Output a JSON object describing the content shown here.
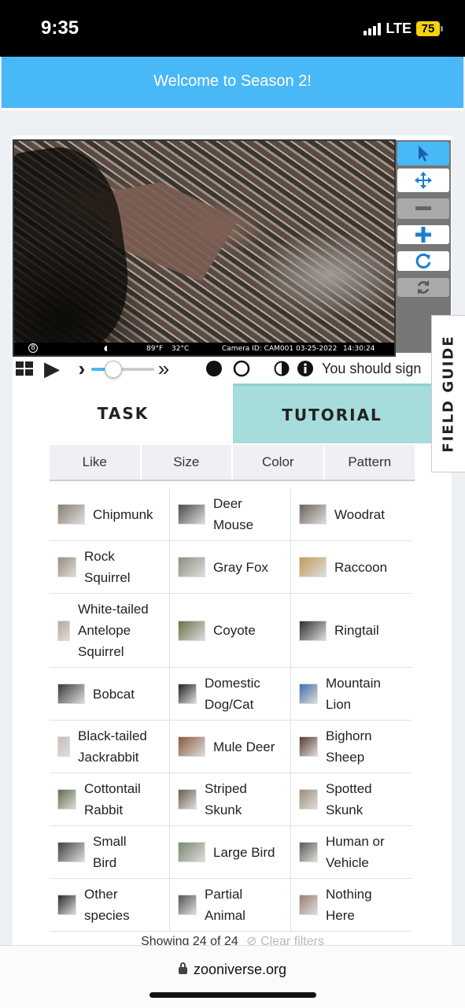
{
  "status_bar": {
    "time": "9:35",
    "network": "LTE",
    "battery": "75"
  },
  "banner": {
    "text": "Welcome to Season 2!"
  },
  "viewer": {
    "caption": {
      "moon": "◖",
      "temp_f": "89°F",
      "temp_c": "32°C",
      "camera": "Camera ID: CAM001",
      "date": "03-25-2022",
      "time": "14:30:24",
      "logo": "8"
    },
    "tools": [
      "pointer-icon",
      "move-icon",
      "zoom-out-icon",
      "zoom-in-icon",
      "rotate-icon",
      "reset-icon"
    ]
  },
  "controls": {
    "play": "▶",
    "next": "›",
    "fast_forward": "»",
    "sign_in_text": "You should sign",
    "slider_value": 0.25
  },
  "tabs": {
    "task": "TASK",
    "tutorial": "TUTORIAL"
  },
  "field_guide": {
    "label": "FIELD GUIDE"
  },
  "filters": [
    "Like",
    "Size",
    "Color",
    "Pattern"
  ],
  "species": [
    {
      "name": "Chipmunk",
      "thumb": "#8a7e72"
    },
    {
      "name": "Deer Mouse",
      "thumb": "#4a4a4a"
    },
    {
      "name": "Woodrat",
      "thumb": "#6e6458"
    },
    {
      "name": "Rock Squirrel",
      "thumb": "#9a8b78"
    },
    {
      "name": "Gray Fox",
      "thumb": "#8e8e80"
    },
    {
      "name": "Raccoon",
      "thumb": "#c49a5a"
    },
    {
      "name": "White-tailed Antelope Squirrel",
      "thumb": "#b9a693"
    },
    {
      "name": "Coyote",
      "thumb": "#6e7048"
    },
    {
      "name": "Ringtail",
      "thumb": "#2e2e2e"
    },
    {
      "name": "Bobcat",
      "thumb": "#3a3a3a"
    },
    {
      "name": "Domestic Dog/Cat",
      "thumb": "#222222"
    },
    {
      "name": "Mountain Lion",
      "thumb": "#3e6fa8"
    },
    {
      "name": "Black-tailed Jackrabbit",
      "thumb": "#c8c0b8"
    },
    {
      "name": "Mule Deer",
      "thumb": "#8a5a3a"
    },
    {
      "name": "Bighorn Sheep",
      "thumb": "#5a3a32"
    },
    {
      "name": "Cottontail Rabbit",
      "thumb": "#5e6e4a"
    },
    {
      "name": "Striped Skunk",
      "thumb": "#6a5e50"
    },
    {
      "name": "Spotted Skunk",
      "thumb": "#9e8e78"
    },
    {
      "name": "Small Bird",
      "thumb": "#404040"
    },
    {
      "name": "Large Bird",
      "thumb": "#7a8870"
    },
    {
      "name": "Human or Vehicle",
      "thumb": "#5e5a50"
    },
    {
      "name": "Other species",
      "thumb": "#2a2a2a"
    },
    {
      "name": "Partial Animal",
      "thumb": "#555555"
    },
    {
      "name": "Nothing Here",
      "thumb": "#9a7e74"
    }
  ],
  "showing": {
    "text": "Showing 24 of 24",
    "clear": "⊘ Clear filters"
  },
  "browser": {
    "url": "zooniverse.org"
  },
  "colors": {
    "accent": "#48b8f7",
    "tutorial_tab": "#a6dcdb"
  }
}
